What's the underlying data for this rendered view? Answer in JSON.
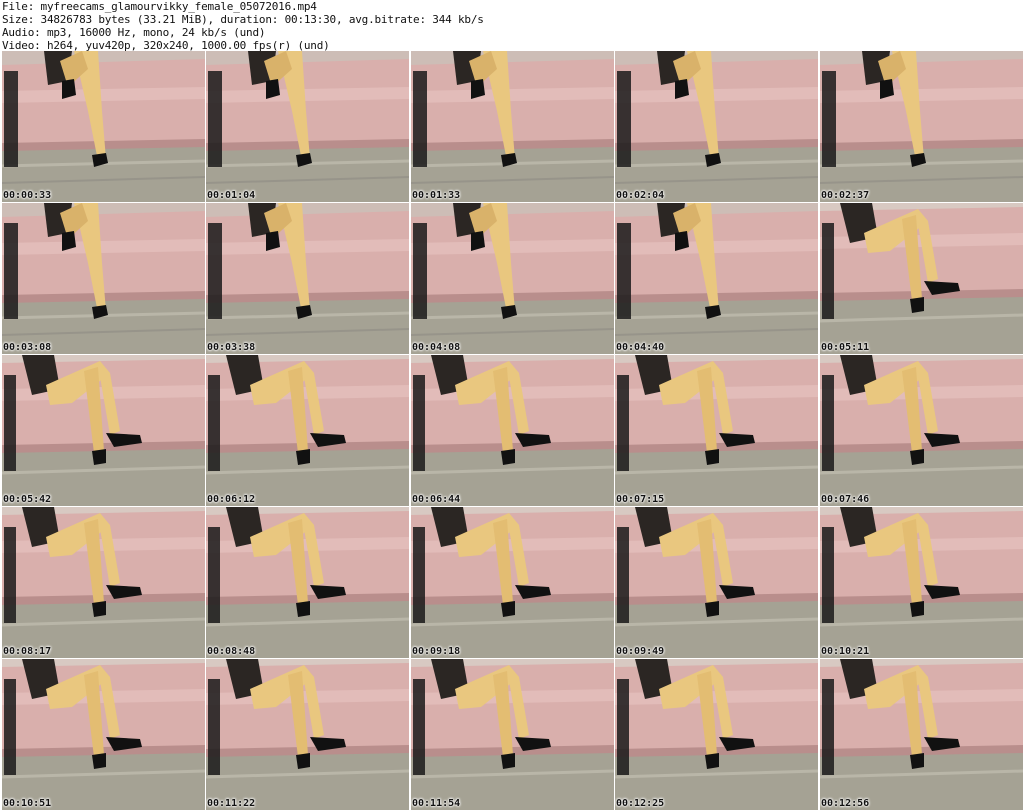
{
  "header": {
    "file": "File: myfreecams_glamourvikky_female_05072016.mp4",
    "size": "Size: 34826783 bytes (33.21 MiB), duration: 00:13:30, avg.bitrate: 344 kb/s",
    "audio": "Audio: mp3, 16000 Hz, mono, 24 kb/s (und)",
    "video": "Video: h264, yuv420p, 320x240, 1000.00 fps(r) (und)"
  },
  "thumbnails": [
    {
      "time": "00:00:33",
      "pose": "seated"
    },
    {
      "time": "00:01:04",
      "pose": "seated"
    },
    {
      "time": "00:01:33",
      "pose": "seated"
    },
    {
      "time": "00:02:04",
      "pose": "seated"
    },
    {
      "time": "00:02:37",
      "pose": "seated"
    },
    {
      "time": "00:03:08",
      "pose": "seated"
    },
    {
      "time": "00:03:38",
      "pose": "seated"
    },
    {
      "time": "00:04:08",
      "pose": "seated"
    },
    {
      "time": "00:04:40",
      "pose": "seated"
    },
    {
      "time": "00:05:11",
      "pose": "crossed"
    },
    {
      "time": "00:05:42",
      "pose": "crossed"
    },
    {
      "time": "00:06:12",
      "pose": "crossed"
    },
    {
      "time": "00:06:44",
      "pose": "crossed"
    },
    {
      "time": "00:07:15",
      "pose": "crossed"
    },
    {
      "time": "00:07:46",
      "pose": "crossed"
    },
    {
      "time": "00:08:17",
      "pose": "crossed"
    },
    {
      "time": "00:08:48",
      "pose": "crossed"
    },
    {
      "time": "00:09:18",
      "pose": "crossed"
    },
    {
      "time": "00:09:49",
      "pose": "crossed"
    },
    {
      "time": "00:10:21",
      "pose": "crossed"
    },
    {
      "time": "00:10:51",
      "pose": "crossed"
    },
    {
      "time": "00:11:22",
      "pose": "crossed"
    },
    {
      "time": "00:11:54",
      "pose": "crossed"
    },
    {
      "time": "00:12:25",
      "pose": "crossed"
    },
    {
      "time": "00:12:56",
      "pose": "crossed"
    }
  ],
  "colors": {
    "background": "#ffffff",
    "wall": "#d8c9c2",
    "couch": "#d9afac",
    "couch_shadow": "#b98e8c",
    "floor": "#a5a294",
    "skin": "#e9c77f",
    "shoe": "#111111",
    "dress": "#2b2623"
  }
}
